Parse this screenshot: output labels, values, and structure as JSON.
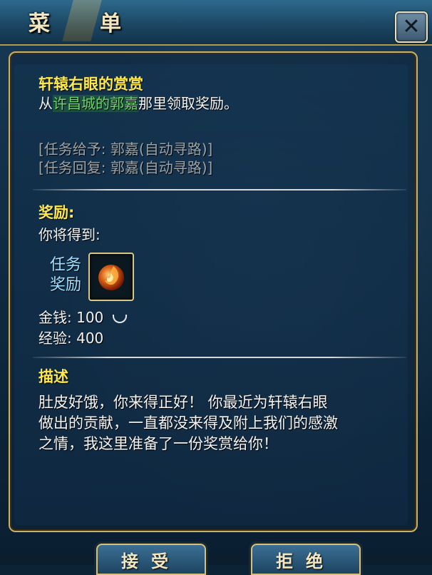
{
  "window": {
    "title": "菜单",
    "title_chars": [
      "菜",
      "单"
    ],
    "close_label": "✕"
  },
  "quest": {
    "title": "轩辕右眼的赏赏",
    "instruction_prefix": "从",
    "npc_link": "许昌城的郭嘉",
    "instruction_suffix": "那里领取奖励。",
    "giver": "[任务给予: 郭嘉(自动寻路)]",
    "returner": "[任务回复: 郭嘉(自动寻路)]"
  },
  "reward": {
    "heading": "奖励:",
    "intro": "你将得到:",
    "label_line1": "任务",
    "label_line2": "奖励",
    "item_icon": "fire-orb-icon",
    "money_label": "金钱:",
    "money_value": "100",
    "money_icon": "silver-ingot-icon",
    "exp_label": "经验:",
    "exp_value": "400"
  },
  "description": {
    "heading": "描述",
    "lines": [
      "肚皮好饿，你来得正好！ 你最近为轩辕右眼",
      "做出的贡献，一直都没来得及附上我们的感激",
      "之情，我这里准备了一份奖赏给你！"
    ]
  },
  "buttons": {
    "accept": "接受",
    "reject": "拒绝"
  },
  "colors": {
    "title_yellow": "#ffe94a",
    "link_green": "#6fd46a",
    "border_gold": "#c9b06a"
  }
}
